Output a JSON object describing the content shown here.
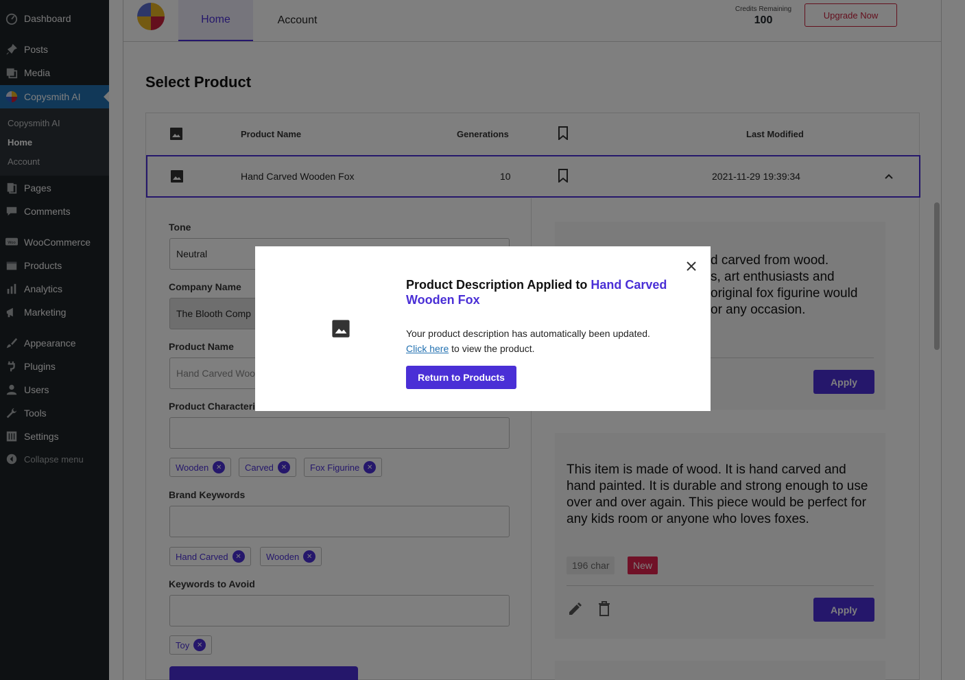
{
  "sidebar": {
    "items": [
      {
        "label": "Dashboard",
        "icon": "dashboard-icon"
      },
      {
        "label": "Posts",
        "icon": "pin-icon"
      },
      {
        "label": "Media",
        "icon": "media-icon"
      },
      {
        "label": "Copysmith AI",
        "icon": "copysmith-icon"
      },
      {
        "label": "Pages",
        "icon": "pages-icon"
      },
      {
        "label": "Comments",
        "icon": "comment-icon"
      },
      {
        "label": "WooCommerce",
        "icon": "woo-icon"
      },
      {
        "label": "Products",
        "icon": "products-icon"
      },
      {
        "label": "Analytics",
        "icon": "analytics-icon"
      },
      {
        "label": "Marketing",
        "icon": "megaphone-icon"
      },
      {
        "label": "Appearance",
        "icon": "brush-icon"
      },
      {
        "label": "Plugins",
        "icon": "plugin-icon"
      },
      {
        "label": "Users",
        "icon": "user-icon"
      },
      {
        "label": "Tools",
        "icon": "wrench-icon"
      },
      {
        "label": "Settings",
        "icon": "settings-icon"
      }
    ],
    "submenu": [
      "Copysmith AI",
      "Home",
      "Account"
    ],
    "collapse": "Collapse menu"
  },
  "header": {
    "tabs": [
      "Home",
      "Account"
    ],
    "credits_label": "Credits Remaining",
    "credits_value": "100",
    "upgrade": "Upgrade Now"
  },
  "page": {
    "title": "Select Product",
    "columns": [
      "Product Name",
      "Generations",
      "Last Modified"
    ],
    "row": {
      "name": "Hand Carved Wooden Fox",
      "generations": "10",
      "modified": "2021-11-29 19:39:34"
    }
  },
  "form": {
    "tone_label": "Tone",
    "tone_value": "Neutral",
    "company_label": "Company Name",
    "company_value": "The Blooth Comp",
    "product_label": "Product Name",
    "product_value": "Hand Carved Woo",
    "characteristics_label": "Product Characteri",
    "characteristics": [
      "Wooden",
      "Carved",
      "Fox Figurine"
    ],
    "brand_label": "Brand Keywords",
    "brand": [
      "Hand Carved",
      "Wooden"
    ],
    "avoid_label": "Keywords to Avoid",
    "avoid": [
      "Toy"
    ]
  },
  "results": {
    "card1_lines": [
      "d carved from wood.",
      "s, art enthusiasts and",
      "original fox figurine would",
      "or any occasion."
    ],
    "card2_text": "This item is made of wood. It is hand carved and hand painted. It is durable and strong enough to use over and over again. This piece would be perfect for any kids room or anyone who loves foxes.",
    "char_count": "196 char",
    "new_badge": "New",
    "apply": "Apply"
  },
  "modal": {
    "title_prefix": "Product Description Applied to ",
    "title_product": "Hand Carved Wooden Fox",
    "body": "Your product description has automatically been updated.",
    "link": "Click here",
    "link_suffix": " to view the product.",
    "button": "Return to Products"
  },
  "colors": {
    "accent": "#4a2fd6",
    "wp_blue": "#2271b1",
    "danger": "#c81e3a"
  }
}
